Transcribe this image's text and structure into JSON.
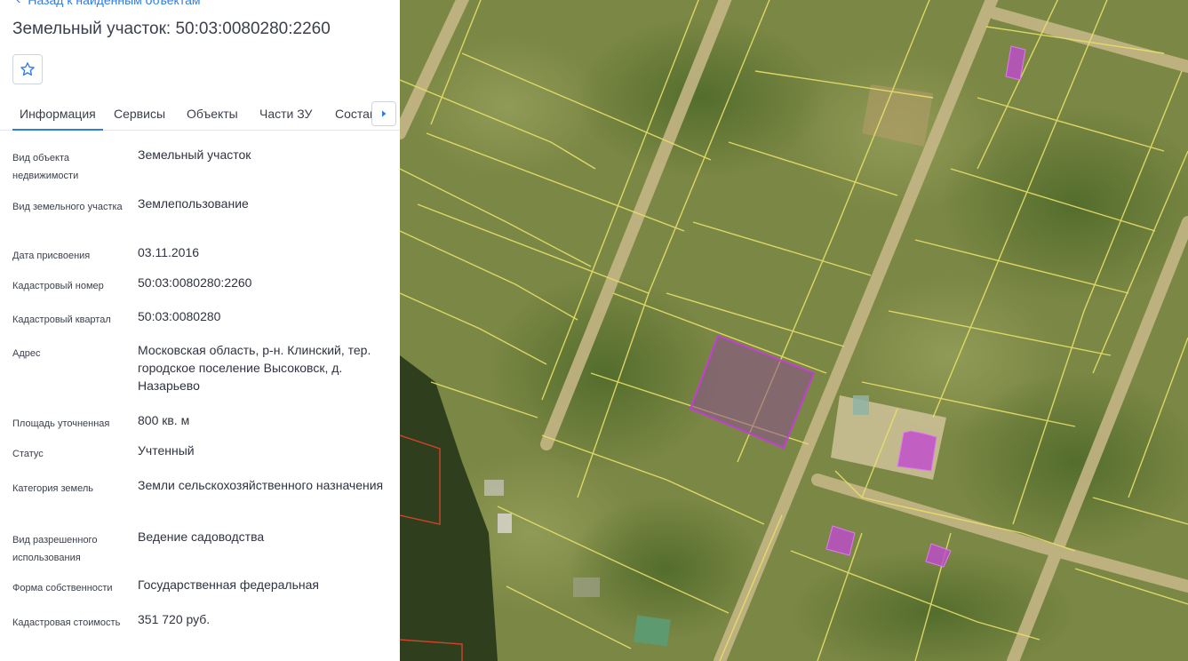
{
  "header": {
    "back_label": "Назад к найденным объектам",
    "title": "Земельный участок: 50:03:0080280:2260"
  },
  "tabs": [
    {
      "label": "Информация",
      "active": true
    },
    {
      "label": "Сервисы",
      "active": false
    },
    {
      "label": "Объекты",
      "active": false
    },
    {
      "label": "Части ЗУ",
      "active": false
    },
    {
      "label": "Состав",
      "active": false
    }
  ],
  "info": [
    {
      "label": "Вид объекта недвижимости",
      "value": "Земельный участок"
    },
    {
      "label": "Вид земельного участка",
      "value": "Землепользование"
    },
    {
      "label": "Дата присвоения",
      "value": "03.11.2016"
    },
    {
      "label": "Кадастровый номер",
      "value": "50:03:0080280:2260"
    },
    {
      "label": "Кадастровый квартал",
      "value": "50:03:0080280"
    },
    {
      "label": "Адрес",
      "value": "Московская область, р-н. Клинский, тер. городское поселение Высоковск, д. Назарьево"
    },
    {
      "label": "Площадь уточненная",
      "value": "800 кв. м"
    },
    {
      "label": "Статус",
      "value": "Учтенный"
    },
    {
      "label": "Категория земель",
      "value": "Земли сельскохозяйственного назначения"
    },
    {
      "label": "Вид разрешенного использования",
      "value": "Ведение садоводства"
    },
    {
      "label": "Форма собственности",
      "value": "Государственная федеральная"
    },
    {
      "label": "Кадастровая стоимость",
      "value": "351 720 руб."
    }
  ],
  "colors": {
    "accent": "#2b7de9",
    "parcel_boundary": "#e8e06a",
    "selected_parcel": "#b03cc0",
    "building_fill": "#c04ad0",
    "other_boundary": "#d0442a"
  },
  "icons": {
    "back": "arrow-left-icon",
    "favorite": "star-icon",
    "tabs_scroll": "chevron-right-icon"
  }
}
